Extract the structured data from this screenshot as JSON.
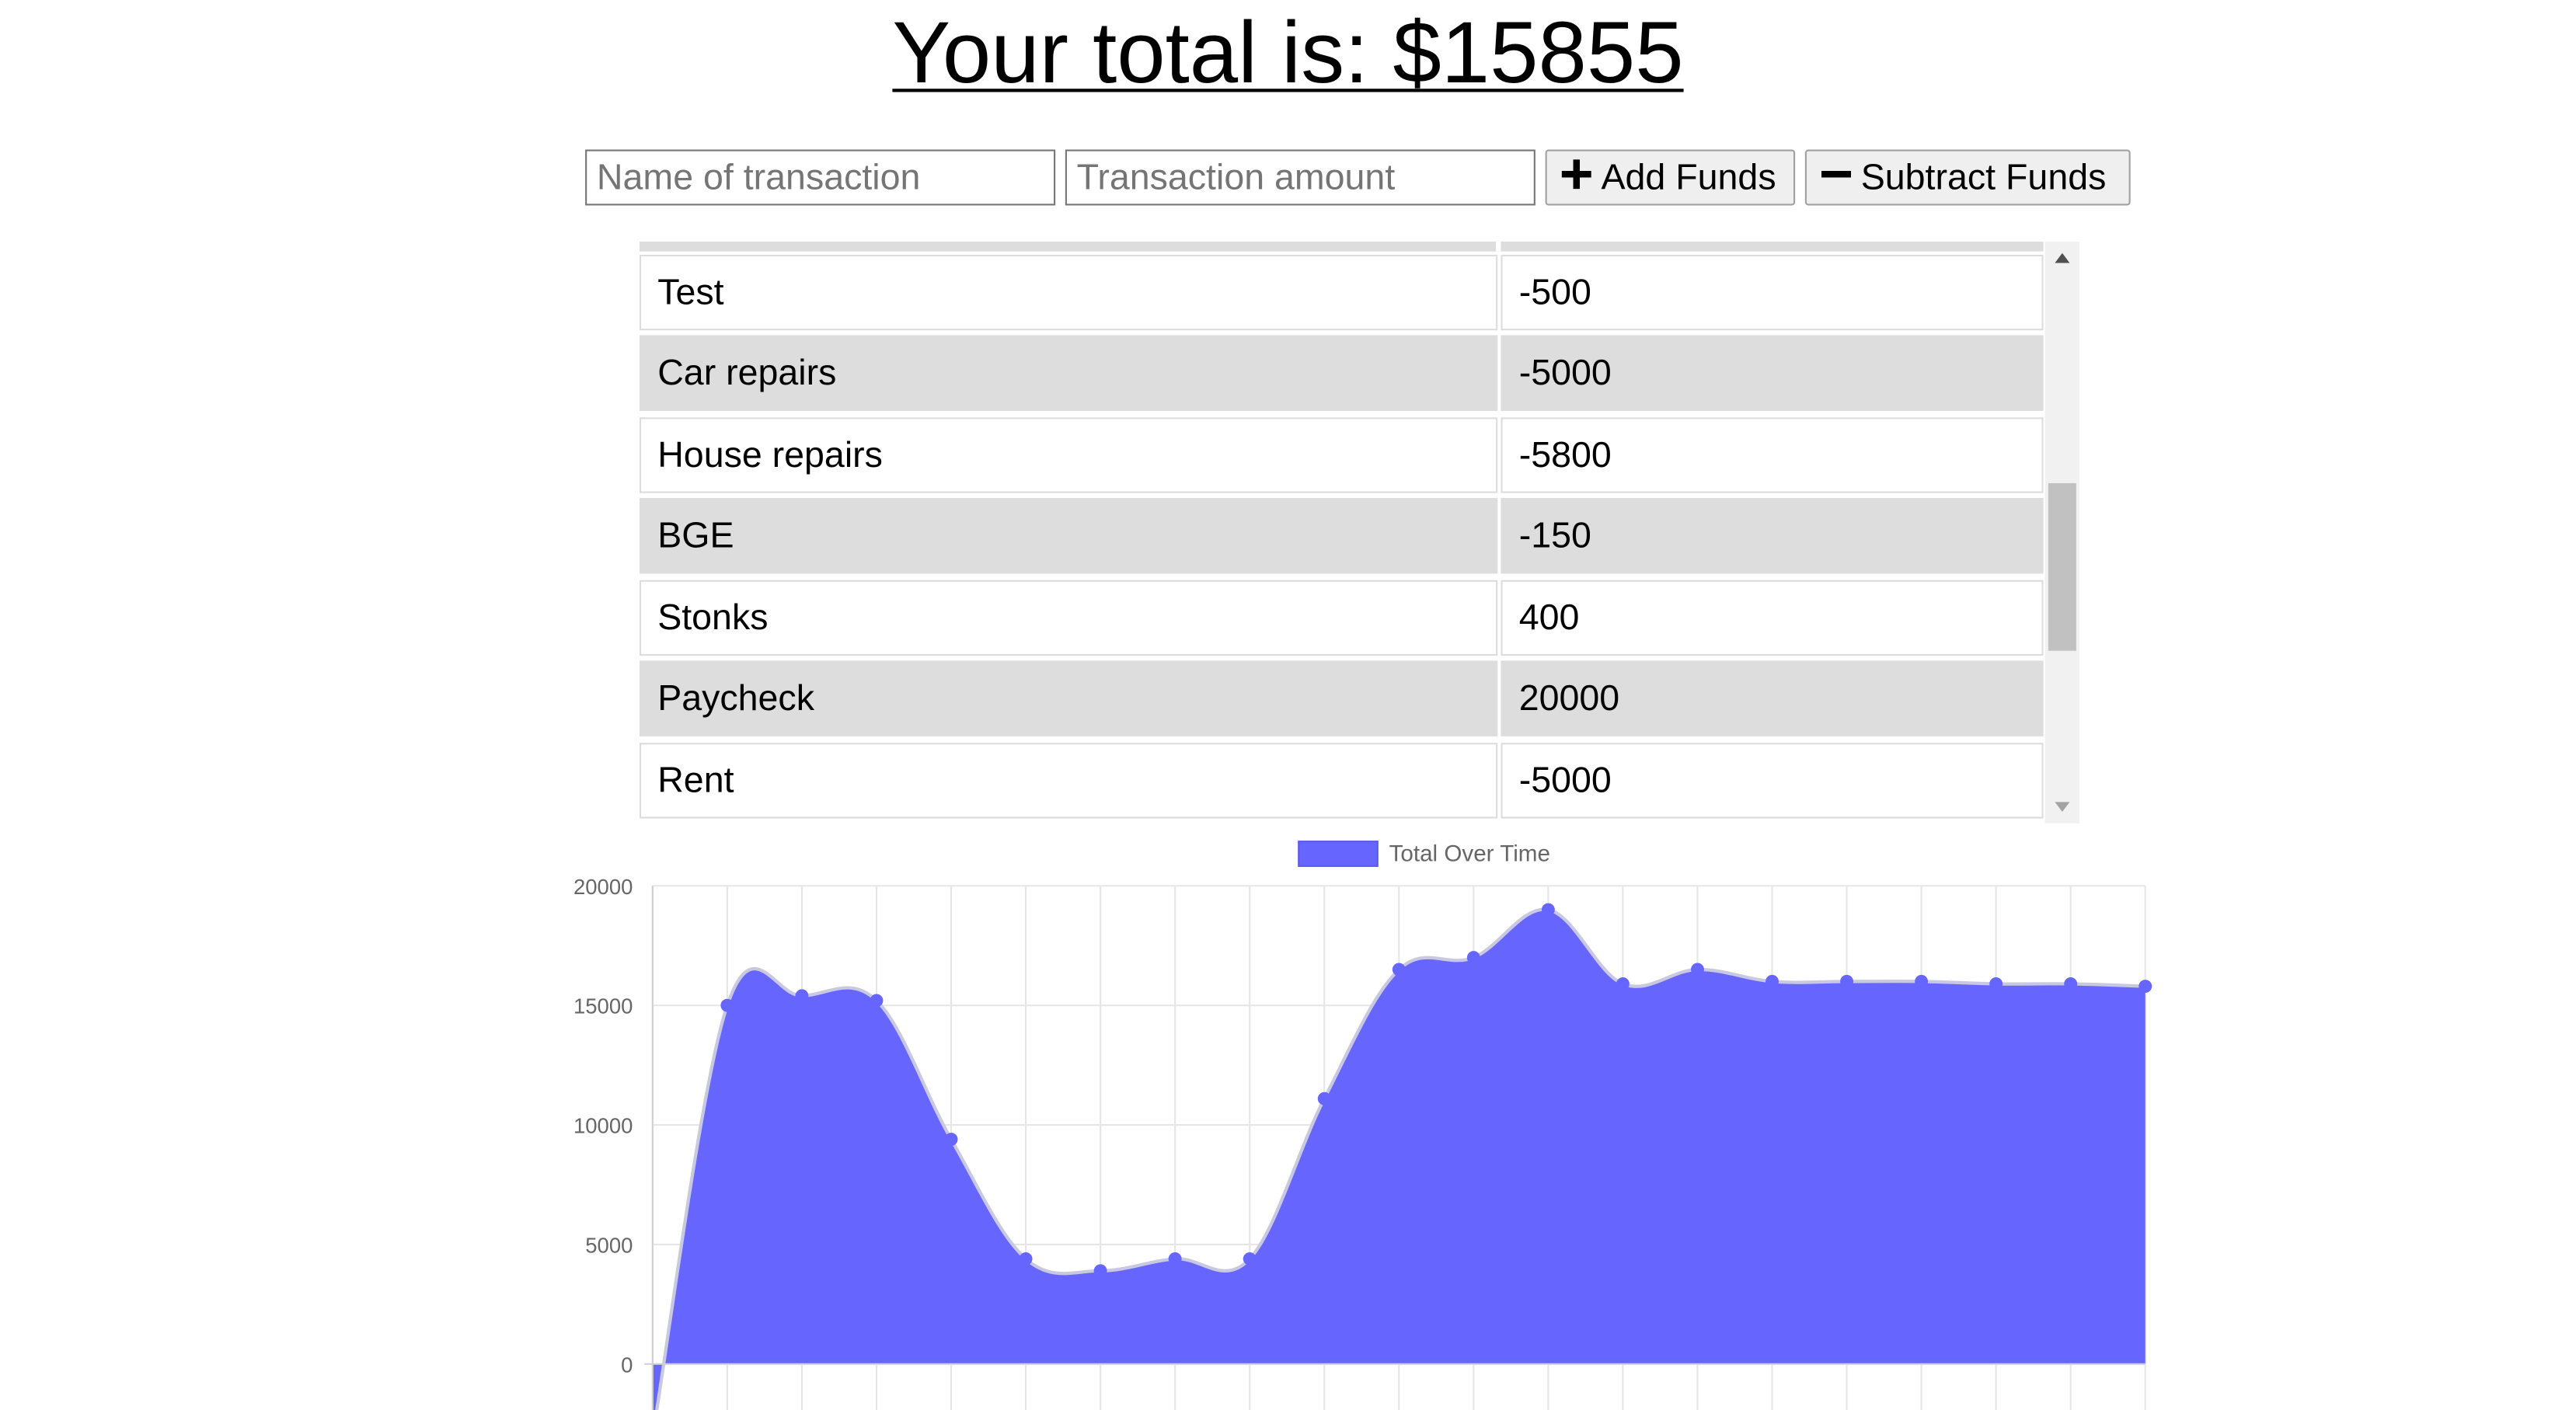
{
  "header": {
    "title": "Your total is: $15855"
  },
  "form": {
    "name_placeholder": "Name of transaction",
    "amount_placeholder": "Transaction amount",
    "add_label": "Add Funds",
    "subtract_label": "Subtract Funds",
    "add_icon": "plus-icon",
    "subtract_icon": "minus-icon"
  },
  "transactions": [
    {
      "name": "Test",
      "amount": "-500"
    },
    {
      "name": "Car repairs",
      "amount": "-5000"
    },
    {
      "name": "House repairs",
      "amount": "-5800"
    },
    {
      "name": "BGE",
      "amount": "-150"
    },
    {
      "name": "Stonks",
      "amount": "400"
    },
    {
      "name": "Paycheck",
      "amount": "20000"
    },
    {
      "name": "Rent",
      "amount": "-5000"
    }
  ],
  "table_scroll_position": 0.6,
  "colors": {
    "fill": "#6666ff",
    "line": "#c8c8e0",
    "grid": "#e6e6e6",
    "axis_text": "#666666",
    "row_alt": "#dddddd"
  },
  "chart_data": {
    "type": "area",
    "legend": {
      "label": "Total Over Time",
      "position": "top"
    },
    "ylim": [
      0,
      20000
    ],
    "yticks": [
      "20000",
      "15000",
      "10000",
      "5000",
      "0"
    ],
    "grid": true,
    "series": [
      {
        "name": "Total Over Time",
        "values": [
          -3000,
          15000,
          15400,
          15200,
          9400,
          4400,
          3900,
          4400,
          4400,
          11100,
          16500,
          17000,
          19000,
          15900,
          16500,
          16000,
          16000,
          16000,
          15900,
          15900,
          15800
        ]
      }
    ]
  }
}
